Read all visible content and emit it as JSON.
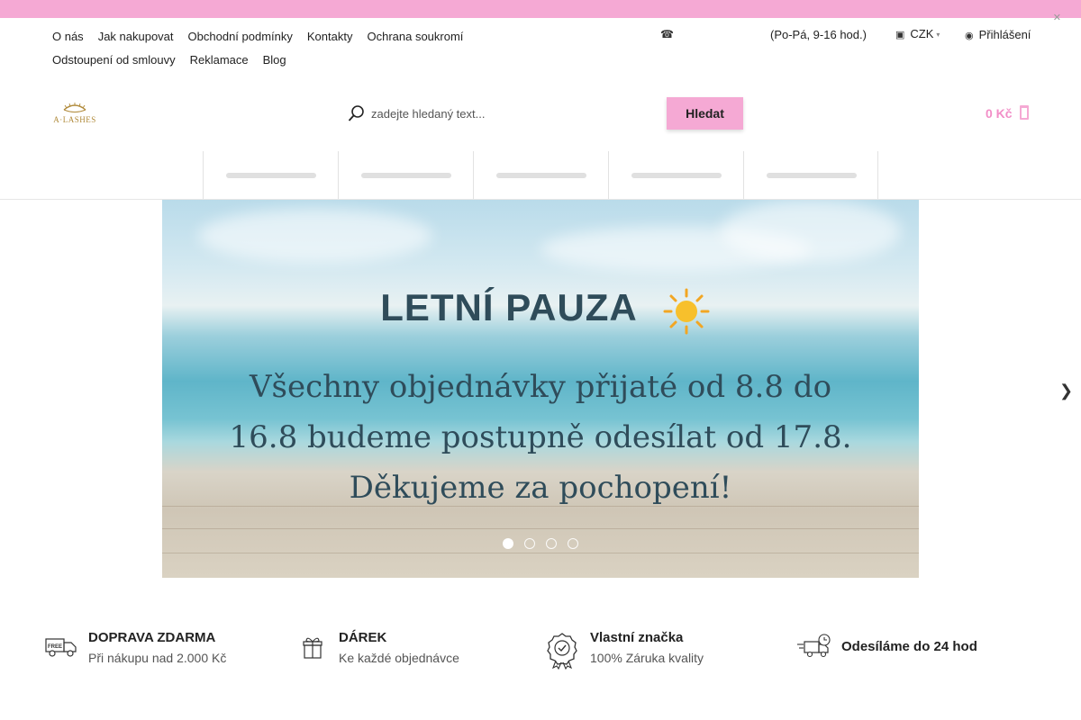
{
  "topbar": {
    "close_icon": "close-icon"
  },
  "header": {
    "links_row1": [
      "O nás",
      "Jak nakupovat",
      "Obchodní podmínky",
      "Kontakty",
      "Ochrana soukromí"
    ],
    "links_row2": [
      "Odstoupení od smlouvy",
      "Reklamace",
      "Blog"
    ],
    "hours": "(Po-Pá, 9-16 hod.)",
    "currency": "CZK",
    "login": "Přihlášení"
  },
  "logo": {
    "text": "A·LASHES"
  },
  "search": {
    "placeholder": "zadejte hledaný text...",
    "button_label": "Hledat"
  },
  "cart": {
    "total": "0 Kč"
  },
  "nav": {
    "item_count_placeholders": 5
  },
  "banner": {
    "title": "LETNÍ PAUZA",
    "text_lines": [
      "Všechny objednávky přijaté od 8.8 do",
      "16.8 budeme postupně odesílat od 17.8.",
      "Děkujeme za pochopení!"
    ],
    "slides": 4,
    "active_slide": 1
  },
  "features": [
    {
      "title": "DOPRAVA ZDARMA",
      "subtitle": "Při nákupu nad 2.000 Kč",
      "icon": "free-delivery-truck-icon"
    },
    {
      "title": "DÁREK",
      "subtitle": "Ke každé objednávce",
      "icon": "gift-icon"
    },
    {
      "title": "Vlastní značka",
      "subtitle": "100% Záruka kvality",
      "icon": "quality-badge-icon"
    },
    {
      "title": "Odesíláme do 24 hod",
      "subtitle": "",
      "icon": "fast-delivery-icon"
    }
  ],
  "colors": {
    "accent_pink": "#f5a9d4",
    "cart_pink": "#f28ec7",
    "logo_gold": "#b08a3a",
    "banner_text": "#2f4c5a"
  }
}
